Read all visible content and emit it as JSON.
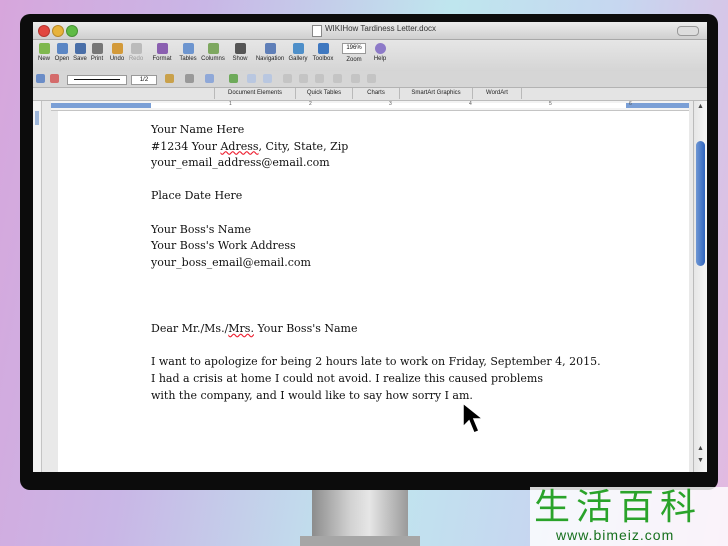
{
  "window": {
    "title": "WIKIHow Tardiness Letter.docx"
  },
  "toolbar": {
    "buttons": [
      {
        "label": "New",
        "icon": "new-document-icon"
      },
      {
        "label": "Open",
        "icon": "open-folder-icon"
      },
      {
        "label": "Save",
        "icon": "save-icon"
      },
      {
        "label": "Print",
        "icon": "print-icon"
      },
      {
        "label": "Undo",
        "icon": "undo-icon"
      },
      {
        "label": "Redo",
        "icon": "redo-icon"
      },
      {
        "label": "Format",
        "icon": "format-brush-icon"
      },
      {
        "label": "Tables",
        "icon": "table-icon"
      },
      {
        "label": "Columns",
        "icon": "columns-icon"
      },
      {
        "label": "Show",
        "icon": "pilcrow-icon"
      },
      {
        "label": "Navigation",
        "icon": "navigation-icon"
      },
      {
        "label": "Gallery",
        "icon": "gallery-icon"
      },
      {
        "label": "Toolbox",
        "icon": "toolbox-icon"
      },
      {
        "label": "Zoom",
        "icon": "zoom-icon"
      },
      {
        "label": "Help",
        "icon": "help-icon"
      }
    ],
    "zoom_value": "196%",
    "point_size": "1/2"
  },
  "ribbon": {
    "tabs": [
      "Document Elements",
      "Quick Tables",
      "Charts",
      "SmartArt Graphics",
      "WordArt"
    ]
  },
  "ruler": {
    "numbers": [
      "1",
      "2",
      "3",
      "4",
      "5",
      "6"
    ]
  },
  "document": {
    "lines": [
      "Your Name Here",
      "#1234 Your Adress, City, State, Zip",
      "your_email_address@email.com",
      "",
      "Place Date Here",
      "",
      "Your Boss's Name",
      "Your Boss's Work Address",
      "your_boss_email@email.com",
      "",
      "",
      "",
      "Dear Mr./Ms./Mrs. Your Boss's Name",
      "",
      "I want to apologize for being 2 hours late to work on Friday, September 4, 2015.",
      "I had a crisis at home I could not avoid. I realize this caused problems",
      "with the company, and I would like to say how sorry I am."
    ]
  },
  "watermark": {
    "chinese": "生活百科",
    "url": "www.bimeiz.com"
  },
  "colors": {
    "accent_blue": "#2f64bd",
    "spell_error": "#e22233"
  }
}
